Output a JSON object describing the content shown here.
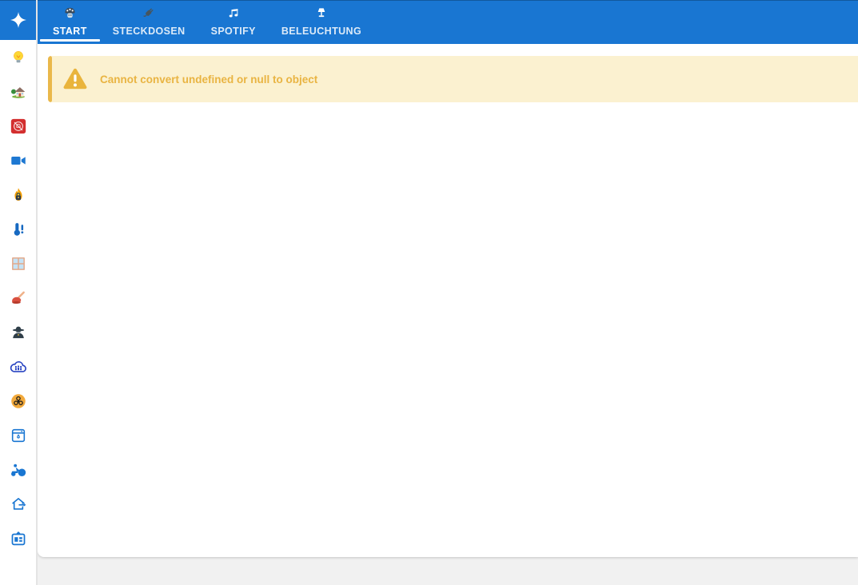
{
  "topbar": {
    "color": "#1976d2",
    "tabs": [
      {
        "label": "START",
        "icon": "mushroom-icon",
        "active": true
      },
      {
        "label": "STECKDOSEN",
        "icon": "plug-icon",
        "active": false
      },
      {
        "label": "SPOTIFY",
        "icon": "music-note-icon",
        "active": false
      },
      {
        "label": "BELEUCHTUNG",
        "icon": "lamp-icon",
        "active": false
      }
    ]
  },
  "sidebar": {
    "items": [
      {
        "icon": "sparkle-icon",
        "selected": true
      },
      {
        "icon": "lightbulb-icon",
        "selected": false
      },
      {
        "icon": "house-garden-icon",
        "selected": false
      },
      {
        "icon": "alarm-off-icon",
        "selected": false
      },
      {
        "icon": "video-camera-icon",
        "selected": false
      },
      {
        "icon": "fire-lock-icon",
        "selected": false
      },
      {
        "icon": "thermometer-alert-icon",
        "selected": false
      },
      {
        "icon": "window-icon",
        "selected": false
      },
      {
        "icon": "plunger-icon",
        "selected": false
      },
      {
        "icon": "spy-icon",
        "selected": false
      },
      {
        "icon": "cloud-family-icon",
        "selected": false
      },
      {
        "icon": "biohazard-icon",
        "selected": false
      },
      {
        "icon": "dishwasher-icon",
        "selected": false
      },
      {
        "icon": "moped-icon",
        "selected": false
      },
      {
        "icon": "home-exit-icon",
        "selected": false
      },
      {
        "icon": "kiosk-icon",
        "selected": false
      }
    ]
  },
  "alert": {
    "message": "Cannot convert undefined or null to object",
    "background": "#fbf1d0",
    "accent_color": "#eab84a",
    "text_color": "#e9b442"
  }
}
